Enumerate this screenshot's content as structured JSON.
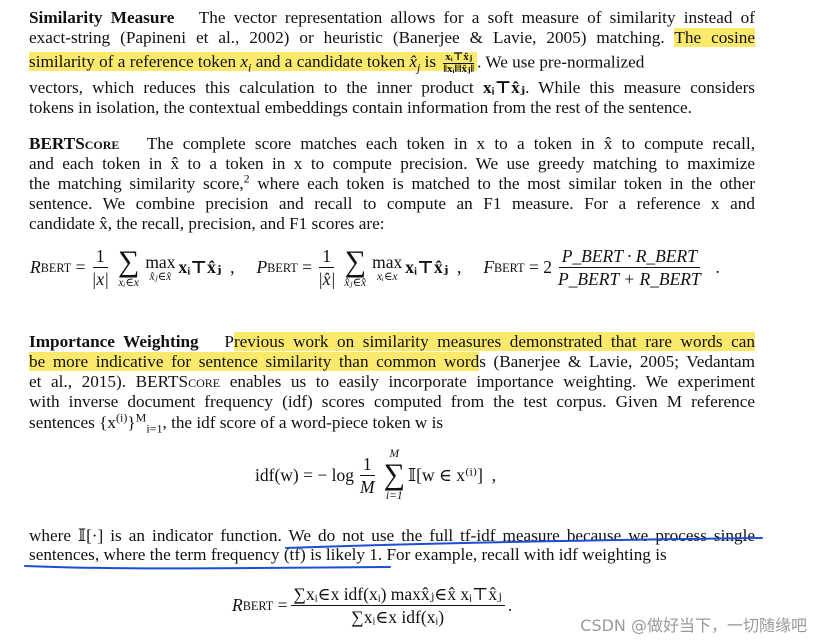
{
  "paragraphs": {
    "similarity": {
      "heading": "Similarity Measure",
      "l1": "The vector representation allows for a soft measure of similarity instead of",
      "l2a": "exact-string (Papineni et al., 2002) or heuristic (Banerjee & Lavie, 2005) matching.",
      "l2b_hl": "The cosine",
      "l3a_hl": "similarity of a reference token",
      "l3_xi": "x",
      "l3_xi_sub": "i",
      "l3b_hl": "and a candidate token",
      "l3_xj": "x̂",
      "l3_xj_sub": "j",
      "l3c_hl": "is",
      "l3_frac_num": "xᵢ⊤x̂ⱼ",
      "l3_frac_den": "‖xᵢ‖‖x̂ⱼ‖",
      "l3d": ". We use pre-normalized",
      "l4a": "vectors, which reduces this calculation to the inner product",
      "l4_math": "xᵢ⊤x̂ⱼ",
      "l4b": ". While this measure considers",
      "l5": "tokens in isolation, the contextual embeddings contain information from the rest of the sentence."
    },
    "bertscore": {
      "heading": "BERTScore",
      "l1": "The complete score matches each token in x to a token in x̂ to compute recall,",
      "l2": "and each token in x̂ to a token in x to compute precision. We use greedy matching to maximize",
      "l3a": "the matching similarity score,",
      "l3_footnote": "2",
      "l3b": "where each token is matched to the most similar token in the other",
      "l4": "sentence. We combine precision and recall to compute an F1 measure. For a reference x and",
      "l5": "candidate x̂, the recall, precision, and F1 scores are:"
    },
    "importance": {
      "heading": "Importance Weighting",
      "l1a": "P",
      "l1b_hl": "revious work on similarity measures demonstrated that rare words can",
      "l2a_hl": "be more indicative for sentence similarity than common word",
      "l2b": "s (Banerjee & Lavie, 2005; Vedantam",
      "l3a": "et al., 2015). ",
      "l3_sc": "BERTScore",
      "l3b": " enables us to easily incorporate importance weighting. We experiment",
      "l4": "with inverse document frequency (idf) scores computed from the test corpus. Given M reference",
      "l5a": "sentences {x",
      "l5_sup": "(i)",
      "l5b": "}",
      "l5_sub": "i=1",
      "l5_sup2": "M",
      "l5c": ", the idf score of a word-piece token w is"
    },
    "indicator": {
      "l1a": "where 𝕀[·] is an indicator function. ",
      "l1b_underlined": "We do not use the full tf-idf measure because we process single",
      "l2_underlined": "sentences, where the term frequency (tf) is likely 1.",
      "l2b": " For example, recall with idf weighting is"
    }
  },
  "equations": {
    "recall": {
      "lhs": "R",
      "lhs_sub": "BERT",
      "frac_num": "1",
      "frac_den": "|x|",
      "sum_lim": "xᵢ∈x",
      "max_lim": "x̂ⱼ∈x̂",
      "term": "xᵢ⊤x̂ⱼ",
      "sep": ","
    },
    "precision": {
      "lhs": "P",
      "lhs_sub": "BERT",
      "frac_num": "1",
      "frac_den": "|x̂|",
      "sum_lim": "x̂ⱼ∈x̂",
      "max_lim": "xᵢ∈x",
      "term": "xᵢ⊤x̂ⱼ",
      "sep": ","
    },
    "f1": {
      "lhs": "F",
      "lhs_sub": "BERT",
      "coef": "2",
      "num": "P_BERT · R_BERT",
      "den": "P_BERT + R_BERT",
      "end": "."
    },
    "idf": {
      "lhs": "idf(w) = − log",
      "frac_num": "1",
      "frac_den": "M",
      "sum_top": "M",
      "sum_bot": "i=1",
      "term": "𝕀[w ∈ x⁽ⁱ⁾]",
      "end": ","
    },
    "recall_idf": {
      "lhs": "R",
      "lhs_sub": "BERT",
      "num": "∑xᵢ∈x idf(xᵢ) maxx̂ⱼ∈x̂ xᵢ⊤x̂ⱼ",
      "den": "∑xᵢ∈x idf(xᵢ)",
      "end": "."
    }
  },
  "annotations": {
    "highlight_color": "#fbe96b",
    "pen_color": "#1a4fd6"
  },
  "watermark": "CSDN @做好当下，一切随缘吧"
}
